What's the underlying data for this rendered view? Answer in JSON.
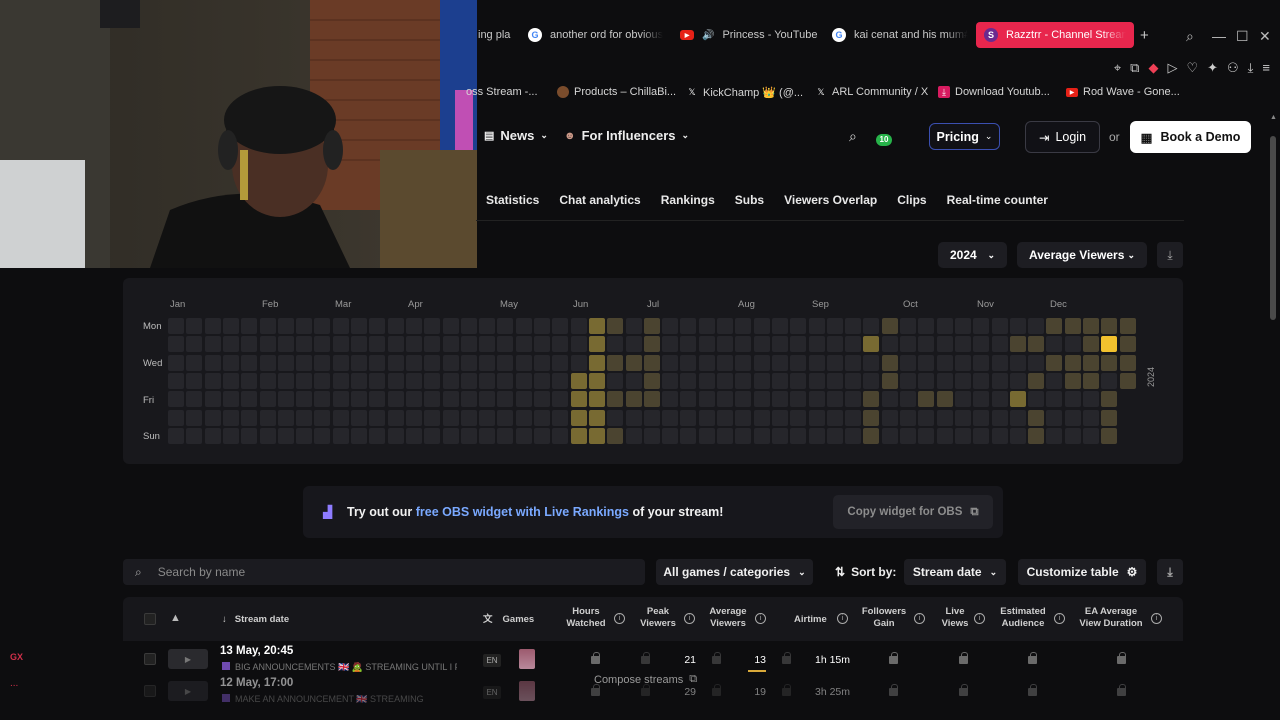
{
  "browser": {
    "tabs": [
      {
        "label": "ing pla",
        "icon": "tab-favicon"
      },
      {
        "label": "another ord for obvious",
        "icon": "google-icon"
      },
      {
        "label": "Princess - YouTube",
        "icon": "youtube-icon"
      },
      {
        "label": "kai cenat and his mum#",
        "icon": "google-icon"
      },
      {
        "label": "Razztrr - Channel Stream",
        "icon": "streamscharts-icon",
        "active": true
      }
    ],
    "bookmarks": [
      {
        "label": "oss Stream -...",
        "icon": "bookmark-icon"
      },
      {
        "label": "Products – ChillaBi...",
        "icon": "chillabi-icon"
      },
      {
        "label": "KickChamp 👑 (@...",
        "icon": "x-icon"
      },
      {
        "label": "ARL Community / X",
        "icon": "x-icon"
      },
      {
        "label": "Download Youtub...",
        "icon": "download-icon"
      },
      {
        "label": "Rod Wave - Gone...",
        "icon": "youtube-icon"
      }
    ],
    "side_label": "GX",
    "side_more": "..."
  },
  "site": {
    "nav": {
      "news": "News",
      "influencers": "For Influencers",
      "notifications": "10",
      "pricing": "Pricing",
      "login": "Login",
      "or": "or",
      "demo": "Book a Demo"
    },
    "subnav": [
      "Statistics",
      "Chat analytics",
      "Rankings",
      "Subs",
      "Viewers Overlap",
      "Clips",
      "Real-time counter"
    ],
    "year_select": "2024",
    "metric_select": "Average Viewers"
  },
  "heatmap": {
    "months": [
      "Jan",
      "Feb",
      "Mar",
      "Apr",
      "May",
      "Jun",
      "Jul",
      "Aug",
      "Sep",
      "Oct",
      "Nov",
      "Dec"
    ],
    "day_labels": [
      "Mon",
      "Wed",
      "Fri",
      "Sun"
    ],
    "year_label": "2024",
    "colors": {
      "empty": "#26262b",
      "low": "#4b4430",
      "mid": "#786a32",
      "high": "#f2c12e"
    }
  },
  "obs": {
    "prefix": "Try out our ",
    "highlight": "free OBS widget with Live Rankings",
    "suffix": " of your stream!",
    "button": "Copy widget for OBS"
  },
  "toolbar": {
    "search_placeholder": "Search by name",
    "games_filter": "All games / categories",
    "sort_label": "Sort by:",
    "sort_value": "Stream date",
    "customize": "Customize table"
  },
  "table": {
    "headers": {
      "stream_date": "Stream date",
      "games": "Games",
      "hours_watched": "Hours\nWatched",
      "peak_viewers": "Peak\nViewers",
      "average_viewers": "Average\nViewers",
      "airtime": "Airtime",
      "followers_gain": "Followers\nGain",
      "live_views": "Live\nViews",
      "estimated_audience": "Estimated\nAudience",
      "ea_avg_view_duration": "EA Average\nView Duration"
    },
    "rows": [
      {
        "date": "13 May, 20:45",
        "title": "BIG ANNOUNCEMENTS 🇬🇧 🧟 STREAMING UNTIL I F",
        "lang": "EN",
        "peak": "21",
        "avg": "13",
        "airtime": "1h 15m"
      },
      {
        "date": "12 May, 17:00",
        "title": "MAKE AN ANNOUNCEMENT 🇬🇧 STREAMING",
        "lang": "EN",
        "peak": "29",
        "avg": "19",
        "airtime": "3h 25m"
      }
    ]
  },
  "compose": "Compose streams"
}
